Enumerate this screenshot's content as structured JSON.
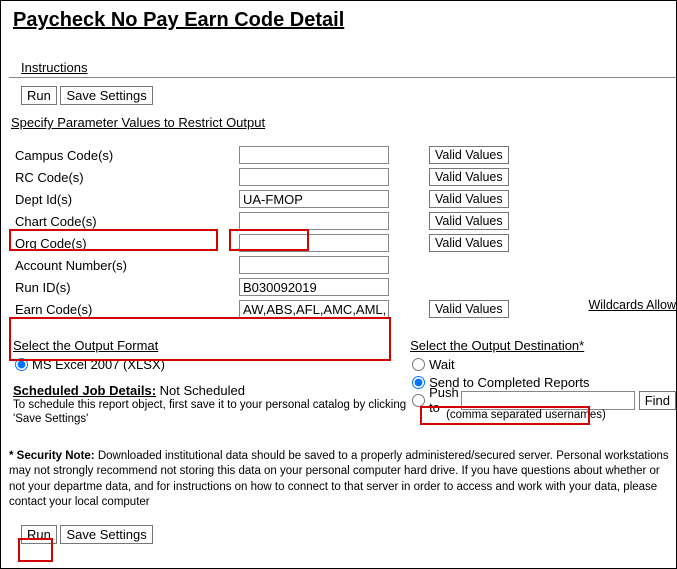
{
  "title": "Paycheck No Pay Earn Code Detail",
  "instructions_label": "Instructions",
  "buttons": {
    "run": "Run",
    "save_settings": "Save Settings",
    "valid_values": "Valid Values",
    "find": "Find"
  },
  "specify_label": "Specify Parameter Values to Restrict Output",
  "params": {
    "campus": {
      "label": "Campus Code(s)",
      "value": ""
    },
    "rc": {
      "label": "RC Code(s)",
      "value": ""
    },
    "dept": {
      "label": "Dept Id(s)",
      "value": "UA-FMOP"
    },
    "chart": {
      "label": "Chart Code(s)",
      "value": ""
    },
    "org": {
      "label": "Org Code(s)",
      "value": ""
    },
    "acct": {
      "label": "Account Number(s)",
      "value": ""
    },
    "runid": {
      "label": "Run ID(s)",
      "value": "B030092019"
    },
    "earn": {
      "label": "Earn Code(s)",
      "value": "AW,ABS,AFL,AMC,AML,AW"
    }
  },
  "wildcards_label": "Wildcards Allow",
  "output_format": {
    "heading": "Select the Output Format",
    "option": "MS Excel 2007 (XLSX)"
  },
  "scheduled": {
    "heading": "Scheduled Job Details:",
    "value": "Not Scheduled",
    "desc": "To schedule this report object, first save it to your personal catalog by clicking 'Save Settings'"
  },
  "destination": {
    "heading": "Select the Output Destination*",
    "wait": "Wait",
    "send": "Send to Completed Reports",
    "push": "Push to",
    "push_value": "",
    "note": "(comma separated usernames)"
  },
  "security_note": {
    "bold": "* Security Note:",
    "text": " Downloaded institutional data should be saved to a properly administered/secured server. Personal workstations may not strongly recommend not storing this data on your personal computer hard drive. If you have questions about whether or not your departme data, and for instructions on how to connect to that server in order to access and work with your data, please contact your local computer"
  }
}
